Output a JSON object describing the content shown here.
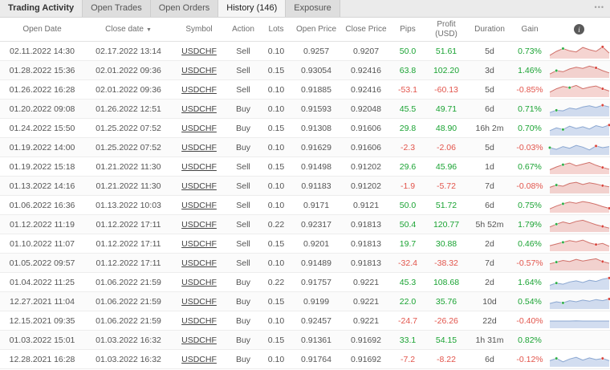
{
  "colors": {
    "positive": "#1aa333",
    "negative": "#e2544b",
    "sell_line": "#d0716a",
    "sell_fill": "rgba(226,132,123,0.35)",
    "buy_line": "#8ba7d1",
    "buy_fill": "rgba(156,180,222,0.45)",
    "marker_green": "#2fae48",
    "marker_red": "#d9453d"
  },
  "tabs": {
    "title": "Trading Activity",
    "items": [
      {
        "label": "Open Trades",
        "active": false
      },
      {
        "label": "Open Orders",
        "active": false
      },
      {
        "label": "History (146)",
        "active": true
      },
      {
        "label": "Exposure",
        "active": false
      }
    ],
    "menu_glyph": "•••"
  },
  "table": {
    "columns": [
      {
        "label": "Open Date"
      },
      {
        "label": "Close date",
        "sort": "▼"
      },
      {
        "label": "Symbol"
      },
      {
        "label": "Action"
      },
      {
        "label": "Lots"
      },
      {
        "label": "Open Price"
      },
      {
        "label": "Close Price"
      },
      {
        "label": "Pips"
      },
      {
        "label": "Profit",
        "sub": "(USD)"
      },
      {
        "label": "Duration"
      },
      {
        "label": "Gain"
      }
    ],
    "info_icon": "i"
  },
  "rows": [
    {
      "open_date": "02.11.2022 14:30",
      "close_date": "02.17.2022 13:14",
      "symbol": "USDCHF",
      "action": "Sell",
      "lots": "0.10",
      "open_price": "0.9257",
      "close_price": "0.9207",
      "pips": "50.0",
      "profit": "51.61",
      "duration": "5d",
      "gain": "0.73%",
      "spark": {
        "variant": "red",
        "values": [
          0.15,
          0.5,
          0.75,
          0.55,
          0.45,
          0.85,
          0.65,
          0.5,
          0.9,
          0.35
        ],
        "markers": {
          "green": 2,
          "red": 8
        }
      }
    },
    {
      "open_date": "01.28.2022 15:36",
      "close_date": "02.01.2022 09:36",
      "symbol": "USDCHF",
      "action": "Sell",
      "lots": "0.15",
      "open_price": "0.93054",
      "close_price": "0.92416",
      "pips": "63.8",
      "profit": "102.20",
      "duration": "3d",
      "gain": "1.46%",
      "spark": {
        "variant": "red",
        "values": [
          0.2,
          0.5,
          0.4,
          0.65,
          0.8,
          0.7,
          0.9,
          0.75,
          0.5,
          0.3
        ],
        "markers": {
          "green": 1,
          "red": 7
        }
      }
    },
    {
      "open_date": "01.26.2022 16:28",
      "close_date": "02.01.2022 09:36",
      "symbol": "USDCHF",
      "action": "Sell",
      "lots": "0.10",
      "open_price": "0.91885",
      "close_price": "0.92416",
      "pips": "-53.1",
      "profit": "-60.13",
      "duration": "5d",
      "gain": "-0.85%",
      "spark": {
        "variant": "red",
        "values": [
          0.3,
          0.6,
          0.8,
          0.7,
          0.9,
          0.6,
          0.75,
          0.85,
          0.6,
          0.4
        ],
        "markers": {
          "green": 3,
          "red": 8
        }
      }
    },
    {
      "open_date": "01.20.2022 09:08",
      "close_date": "01.26.2022 12:51",
      "symbol": "USDCHF",
      "action": "Buy",
      "lots": "0.10",
      "open_price": "0.91593",
      "close_price": "0.92048",
      "pips": "45.5",
      "profit": "49.71",
      "duration": "6d",
      "gain": "0.71%",
      "spark": {
        "variant": "blue",
        "values": [
          0.2,
          0.4,
          0.35,
          0.6,
          0.5,
          0.7,
          0.8,
          0.65,
          0.85,
          0.7
        ],
        "markers": {
          "green": 1,
          "red": 8
        }
      }
    },
    {
      "open_date": "01.24.2022 15:50",
      "close_date": "01.25.2022 07:52",
      "symbol": "USDCHF",
      "action": "Buy",
      "lots": "0.15",
      "open_price": "0.91308",
      "close_price": "0.91606",
      "pips": "29.8",
      "profit": "48.90",
      "duration": "16h 2m",
      "gain": "0.70%",
      "spark": {
        "variant": "blue",
        "values": [
          0.3,
          0.55,
          0.4,
          0.7,
          0.5,
          0.65,
          0.45,
          0.75,
          0.6,
          0.8
        ],
        "markers": {
          "green": 2,
          "red": 9
        }
      }
    },
    {
      "open_date": "01.19.2022 14:00",
      "close_date": "01.25.2022 07:52",
      "symbol": "USDCHF",
      "action": "Buy",
      "lots": "0.10",
      "open_price": "0.91629",
      "close_price": "0.91606",
      "pips": "-2.3",
      "profit": "-2.06",
      "duration": "5d",
      "gain": "-0.03%",
      "spark": {
        "variant": "blue",
        "values": [
          0.5,
          0.35,
          0.6,
          0.45,
          0.7,
          0.55,
          0.3,
          0.65,
          0.5,
          0.6
        ],
        "markers": {
          "green": 0,
          "red": 7
        }
      }
    },
    {
      "open_date": "01.19.2022 15:18",
      "close_date": "01.21.2022 11:30",
      "symbol": "USDCHF",
      "action": "Sell",
      "lots": "0.15",
      "open_price": "0.91498",
      "close_price": "0.91202",
      "pips": "29.6",
      "profit": "45.96",
      "duration": "1d",
      "gain": "0.67%",
      "spark": {
        "variant": "red",
        "values": [
          0.25,
          0.5,
          0.7,
          0.85,
          0.6,
          0.75,
          0.9,
          0.65,
          0.45,
          0.3
        ],
        "markers": {
          "green": 2,
          "red": 8
        }
      }
    },
    {
      "open_date": "01.13.2022 14:16",
      "close_date": "01.21.2022 11:30",
      "symbol": "USDCHF",
      "action": "Sell",
      "lots": "0.10",
      "open_price": "0.91183",
      "close_price": "0.91202",
      "pips": "-1.9",
      "profit": "-5.72",
      "duration": "7d",
      "gain": "-0.08%",
      "spark": {
        "variant": "red",
        "values": [
          0.4,
          0.6,
          0.5,
          0.75,
          0.85,
          0.65,
          0.8,
          0.7,
          0.55,
          0.45
        ],
        "markers": {
          "green": 1,
          "red": 8
        }
      }
    },
    {
      "open_date": "01.06.2022 16:36",
      "close_date": "01.13.2022 10:03",
      "symbol": "USDCHF",
      "action": "Sell",
      "lots": "0.10",
      "open_price": "0.9171",
      "close_price": "0.9121",
      "pips": "50.0",
      "profit": "51.72",
      "duration": "6d",
      "gain": "0.75%",
      "spark": {
        "variant": "red",
        "values": [
          0.2,
          0.45,
          0.65,
          0.8,
          0.7,
          0.85,
          0.75,
          0.6,
          0.4,
          0.25
        ],
        "markers": {
          "green": 2,
          "red": 9
        }
      }
    },
    {
      "open_date": "01.12.2022 11:19",
      "close_date": "01.12.2022 17:11",
      "symbol": "USDCHF",
      "action": "Sell",
      "lots": "0.22",
      "open_price": "0.92317",
      "close_price": "0.91813",
      "pips": "50.4",
      "profit": "120.77",
      "duration": "5h 52m",
      "gain": "1.79%",
      "spark": {
        "variant": "red",
        "values": [
          0.3,
          0.55,
          0.75,
          0.6,
          0.8,
          0.9,
          0.7,
          0.5,
          0.35,
          0.2
        ],
        "markers": {
          "green": 1,
          "red": 8
        }
      }
    },
    {
      "open_date": "01.10.2022 11:07",
      "close_date": "01.12.2022 17:11",
      "symbol": "USDCHF",
      "action": "Sell",
      "lots": "0.15",
      "open_price": "0.9201",
      "close_price": "0.91813",
      "pips": "19.7",
      "profit": "30.88",
      "duration": "2d",
      "gain": "0.46%",
      "spark": {
        "variant": "red",
        "values": [
          0.35,
          0.5,
          0.65,
          0.8,
          0.7,
          0.85,
          0.6,
          0.45,
          0.55,
          0.3
        ],
        "markers": {
          "green": 2,
          "red": 7
        }
      }
    },
    {
      "open_date": "01.05.2022 09:57",
      "close_date": "01.12.2022 17:11",
      "symbol": "USDCHF",
      "action": "Sell",
      "lots": "0.10",
      "open_price": "0.91489",
      "close_price": "0.91813",
      "pips": "-32.4",
      "profit": "-38.32",
      "duration": "7d",
      "gain": "-0.57%",
      "spark": {
        "variant": "red",
        "values": [
          0.45,
          0.6,
          0.75,
          0.65,
          0.85,
          0.7,
          0.8,
          0.9,
          0.65,
          0.5
        ],
        "markers": {
          "green": 1,
          "red": 8
        }
      }
    },
    {
      "open_date": "01.04.2022 11:25",
      "close_date": "01.06.2022 21:59",
      "symbol": "USDCHF",
      "action": "Buy",
      "lots": "0.22",
      "open_price": "0.91757",
      "close_price": "0.9221",
      "pips": "45.3",
      "profit": "108.68",
      "duration": "2d",
      "gain": "1.64%",
      "spark": {
        "variant": "blue",
        "values": [
          0.25,
          0.45,
          0.35,
          0.55,
          0.65,
          0.5,
          0.7,
          0.6,
          0.8,
          0.9
        ],
        "markers": {
          "green": 1,
          "red": 9
        }
      }
    },
    {
      "open_date": "12.27.2021 11:04",
      "close_date": "01.06.2022 21:59",
      "symbol": "USDCHF",
      "action": "Buy",
      "lots": "0.15",
      "open_price": "0.9199",
      "close_price": "0.9221",
      "pips": "22.0",
      "profit": "35.76",
      "duration": "10d",
      "gain": "0.54%",
      "spark": {
        "variant": "blue",
        "values": [
          0.35,
          0.5,
          0.4,
          0.6,
          0.5,
          0.65,
          0.55,
          0.7,
          0.6,
          0.75
        ],
        "markers": {
          "green": 2,
          "red": 9
        }
      }
    },
    {
      "open_date": "12.15.2021 09:35",
      "close_date": "01.06.2022 21:59",
      "symbol": "USDCHF",
      "action": "Buy",
      "lots": "0.10",
      "open_price": "0.92457",
      "close_price": "0.9221",
      "pips": "-24.7",
      "profit": "-26.26",
      "duration": "22d",
      "gain": "-0.40%",
      "spark": {
        "variant": "blue",
        "values": [
          0.5,
          0.5,
          0.5,
          0.5,
          0.52,
          0.5,
          0.5,
          0.5,
          0.5,
          0.5
        ]
      }
    },
    {
      "open_date": "01.03.2022 15:01",
      "close_date": "01.03.2022 16:32",
      "symbol": "USDCHF",
      "action": "Buy",
      "lots": "0.15",
      "open_price": "0.91361",
      "close_price": "0.91692",
      "pips": "33.1",
      "profit": "54.15",
      "duration": "1h 31m",
      "gain": "0.82%",
      "spark": null
    },
    {
      "open_date": "12.28.2021 16:28",
      "close_date": "01.03.2022 16:32",
      "symbol": "USDCHF",
      "action": "Buy",
      "lots": "0.10",
      "open_price": "0.91764",
      "close_price": "0.91692",
      "pips": "-7.2",
      "profit": "-8.22",
      "duration": "6d",
      "gain": "-0.12%",
      "spark": {
        "variant": "blue",
        "values": [
          0.4,
          0.6,
          0.3,
          0.55,
          0.7,
          0.45,
          0.65,
          0.5,
          0.6,
          0.4
        ],
        "markers": {
          "green": 1,
          "red": 8
        }
      }
    }
  ]
}
